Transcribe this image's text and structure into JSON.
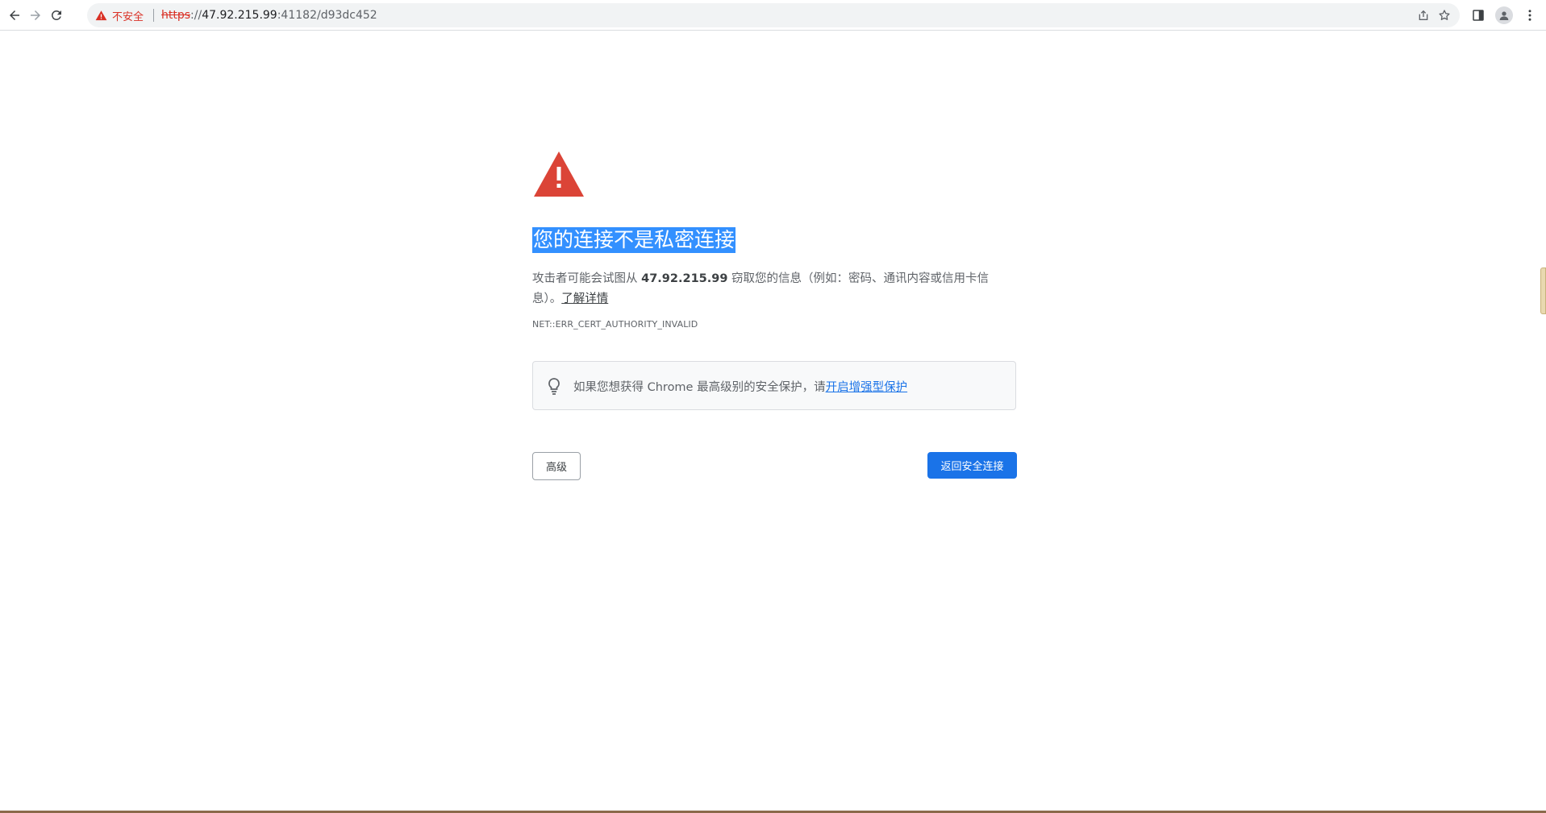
{
  "toolbar": {
    "security_label": "不安全",
    "url_scheme": "https",
    "url_separator": "://",
    "url_host": "47.92.215.99",
    "url_rest": ":41182/d93dc452",
    "icons": {
      "back": "back-arrow-icon",
      "forward": "forward-arrow-icon",
      "reload": "reload-icon",
      "warning": "warning-triangle-icon",
      "share": "share-icon",
      "bookmark": "star-icon",
      "side_panel": "side-panel-icon",
      "profile": "profile-icon",
      "menu": "kebab-menu-icon"
    }
  },
  "interstitial": {
    "heading": "您的连接不是私密连接",
    "explanation_prefix": "攻击者可能会试图从 ",
    "explanation_host": "47.92.215.99",
    "explanation_suffix": " 窃取您的信息（例如：密码、通讯内容或信用卡信息）。",
    "learn_more": "了解详情",
    "error_code": "NET::ERR_CERT_AUTHORITY_INVALID",
    "enhanced_protection_text": "如果您想获得 Chrome 最高级别的安全保护，请",
    "enhanced_protection_link": "开启增强型保护",
    "advanced_button": "高级",
    "back_to_safety_button": "返回安全连接"
  },
  "colors": {
    "danger": "#d93025",
    "warning_icon": "#db4437",
    "primary": "#1a73e8",
    "selection": "#3390ff"
  }
}
